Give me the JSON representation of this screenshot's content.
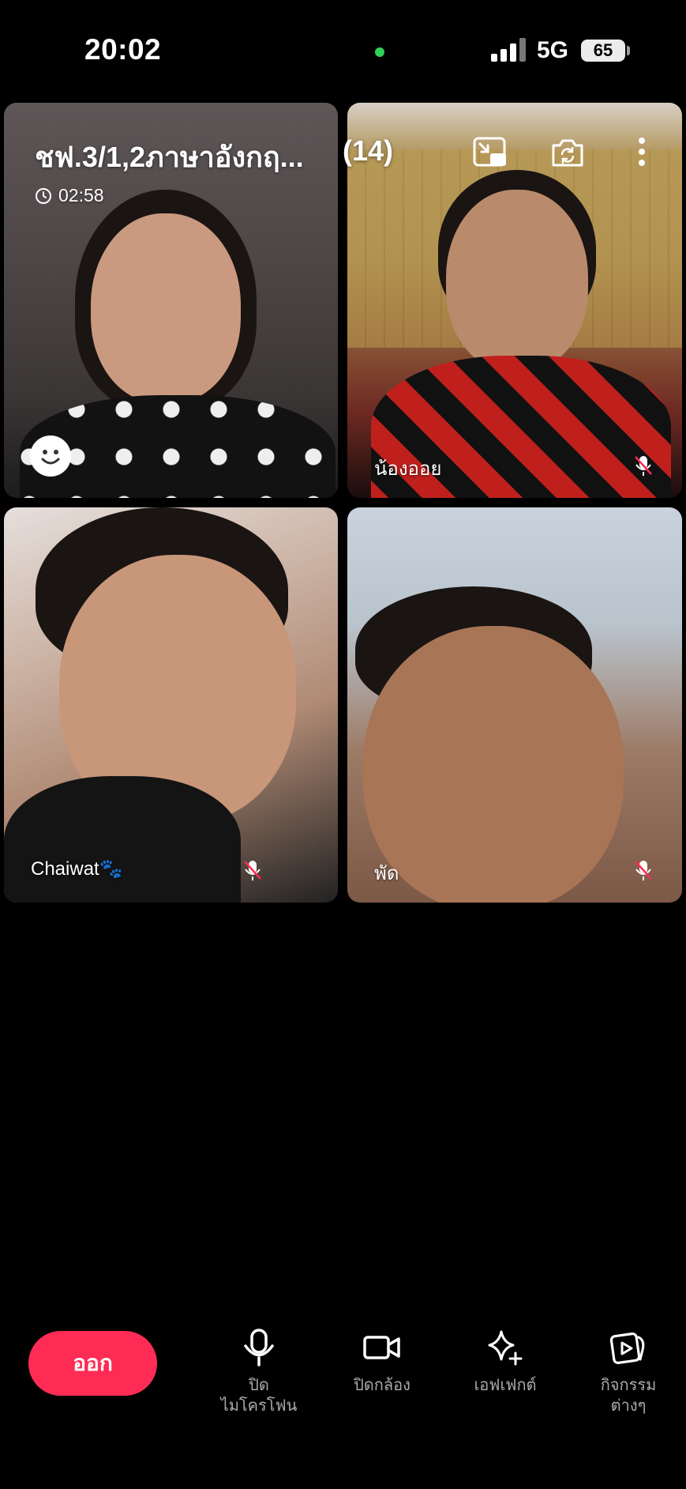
{
  "status_bar": {
    "time": "20:02",
    "network": "5G",
    "battery": "65"
  },
  "call": {
    "title": "ชฟ.3/1,2ภาษาอังกฤ...",
    "participant_count": "(14)",
    "duration": "02:58"
  },
  "participants": [
    {
      "name": ""
    },
    {
      "name": "น้องออย"
    },
    {
      "name": "Chaiwat🐾"
    },
    {
      "name": "พัด"
    }
  ],
  "controls": {
    "leave": "ออก",
    "mic": "ปิด\nไมโครโฟน",
    "camera": "ปิดกล้อง",
    "effects": "เอฟเฟกต์",
    "activities": "กิจกรรม\nต่างๆ"
  },
  "colors": {
    "accent": "#fe2c55",
    "live_dot": "#2fd158"
  }
}
